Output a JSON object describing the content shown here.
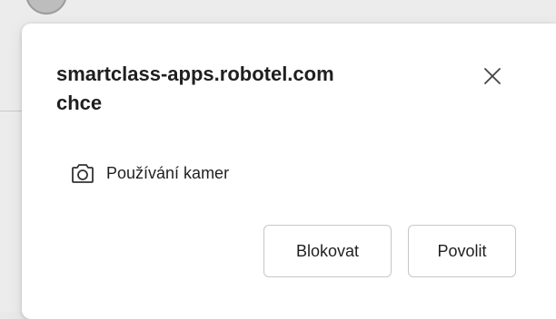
{
  "dialog": {
    "title_line1": "smartclass-apps.robotel.com",
    "title_line2": "chce",
    "close_icon": "close-icon",
    "permission": {
      "icon": "camera-icon",
      "label": "Používání kamer"
    },
    "buttons": {
      "block_label": "Blokovat",
      "allow_label": "Povolit"
    }
  },
  "colors": {
    "text": "#1f1f1f",
    "button_border": "#c7c7c7",
    "popup_bg": "#ffffff",
    "backdrop": "#ececec"
  }
}
